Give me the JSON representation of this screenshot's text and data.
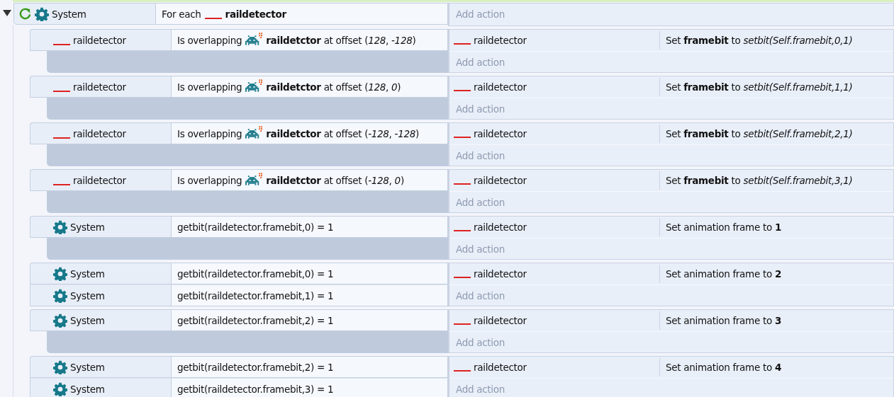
{
  "event": {
    "expanded": true,
    "conditions": [
      {
        "object": {
          "kind": "system",
          "name": "System"
        },
        "loop": true,
        "params": [
          {
            "kind": "text",
            "text": "For each"
          },
          {
            "kind": "blank"
          },
          {
            "kind": "text",
            "text": "**raildetector**"
          }
        ]
      }
    ],
    "add_action": "Add action",
    "children": [
      {
        "conditions": [
          {
            "object": {
              "kind": "sprite",
              "name": "raildetector"
            },
            "loop": false,
            "params": [
              {
                "kind": "text",
                "text": "Is overlapping"
              },
              {
                "kind": "invader"
              },
              {
                "kind": "text",
                "text": "**raildetctor** at offset (*128*, *-128*)"
              }
            ]
          }
        ],
        "actions": [
          {
            "object": {
              "kind": "sprite",
              "name": "raildetector"
            },
            "text": "Set **framebit** to *setbit(Self.framebit,0,1)*"
          }
        ],
        "add_action": "Add action"
      },
      {
        "conditions": [
          {
            "object": {
              "kind": "sprite",
              "name": "raildetector"
            },
            "loop": false,
            "params": [
              {
                "kind": "text",
                "text": "Is overlapping"
              },
              {
                "kind": "invader"
              },
              {
                "kind": "text",
                "text": "**raildetctor** at offset (*128*, *0*)"
              }
            ]
          }
        ],
        "actions": [
          {
            "object": {
              "kind": "sprite",
              "name": "raildetector"
            },
            "text": "Set **framebit** to *setbit(Self.framebit,1,1)*"
          }
        ],
        "add_action": "Add action"
      },
      {
        "conditions": [
          {
            "object": {
              "kind": "sprite",
              "name": "raildetector"
            },
            "loop": false,
            "params": [
              {
                "kind": "text",
                "text": "Is overlapping"
              },
              {
                "kind": "invader"
              },
              {
                "kind": "text",
                "text": "**raildetctor** at offset (*-128*, *-128*)"
              }
            ]
          }
        ],
        "actions": [
          {
            "object": {
              "kind": "sprite",
              "name": "raildetector"
            },
            "text": "Set **framebit** to *setbit(Self.framebit,2,1)*"
          }
        ],
        "add_action": "Add action"
      },
      {
        "conditions": [
          {
            "object": {
              "kind": "sprite",
              "name": "raildetector"
            },
            "loop": false,
            "params": [
              {
                "kind": "text",
                "text": "Is overlapping"
              },
              {
                "kind": "invader"
              },
              {
                "kind": "text",
                "text": "**raildetctor** at offset (*-128*, *0*)"
              }
            ]
          }
        ],
        "actions": [
          {
            "object": {
              "kind": "sprite",
              "name": "raildetector"
            },
            "text": "Set **framebit** to *setbit(Self.framebit,3,1)*"
          }
        ],
        "add_action": "Add action"
      },
      {
        "conditions": [
          {
            "object": {
              "kind": "system",
              "name": "System"
            },
            "loop": false,
            "params": [
              {
                "kind": "text",
                "text": "getbit(raildetector.framebit,0) = 1"
              }
            ]
          }
        ],
        "actions": [
          {
            "object": {
              "kind": "sprite",
              "name": "raildetector"
            },
            "text": "Set animation frame to **1**"
          }
        ],
        "add_action": "Add action"
      },
      {
        "conditions": [
          {
            "object": {
              "kind": "system",
              "name": "System"
            },
            "loop": false,
            "params": [
              {
                "kind": "text",
                "text": "getbit(raildetector.framebit,0) = 1"
              }
            ]
          },
          {
            "object": {
              "kind": "system",
              "name": "System"
            },
            "loop": false,
            "params": [
              {
                "kind": "text",
                "text": "getbit(raildetector.framebit,1) = 1"
              }
            ]
          }
        ],
        "actions": [
          {
            "object": {
              "kind": "sprite",
              "name": "raildetector"
            },
            "text": "Set animation frame to **2**"
          }
        ],
        "add_action": "Add action"
      },
      {
        "conditions": [
          {
            "object": {
              "kind": "system",
              "name": "System"
            },
            "loop": false,
            "params": [
              {
                "kind": "text",
                "text": "getbit(raildetector.framebit,2) = 1"
              }
            ]
          }
        ],
        "actions": [
          {
            "object": {
              "kind": "sprite",
              "name": "raildetector"
            },
            "text": "Set animation frame to **3**"
          }
        ],
        "add_action": "Add action"
      },
      {
        "conditions": [
          {
            "object": {
              "kind": "system",
              "name": "System"
            },
            "loop": false,
            "params": [
              {
                "kind": "text",
                "text": "getbit(raildetector.framebit,2) = 1"
              }
            ]
          },
          {
            "object": {
              "kind": "system",
              "name": "System"
            },
            "loop": false,
            "params": [
              {
                "kind": "text",
                "text": "getbit(raildetector.framebit,3) = 1"
              }
            ]
          }
        ],
        "actions": [
          {
            "object": {
              "kind": "sprite",
              "name": "raildetector"
            },
            "text": "Set animation frame to **4**"
          }
        ],
        "add_action": "Add action"
      }
    ]
  }
}
